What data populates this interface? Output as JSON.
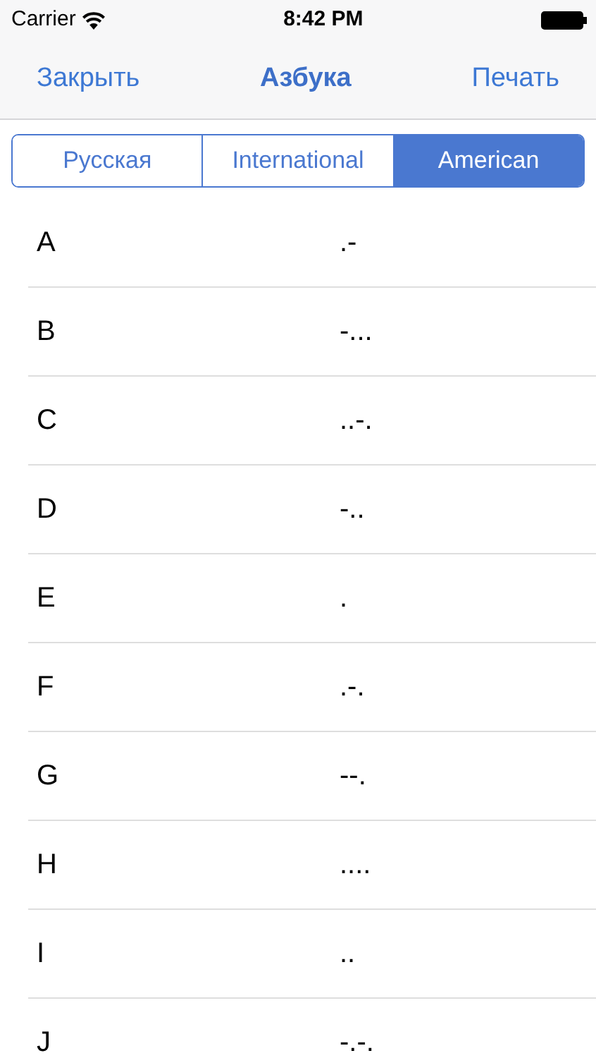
{
  "status_bar": {
    "carrier": "Carrier",
    "time": "8:42 PM"
  },
  "nav_bar": {
    "left_button": "Закрыть",
    "title": "Азбука",
    "right_button": "Печать"
  },
  "segments": [
    {
      "label": "Русская",
      "selected": false
    },
    {
      "label": "International",
      "selected": false
    },
    {
      "label": "American",
      "selected": true
    }
  ],
  "rows": [
    {
      "letter": "A",
      "code": ".-"
    },
    {
      "letter": "B",
      "code": "-..."
    },
    {
      "letter": "C",
      "code": "..-."
    },
    {
      "letter": "D",
      "code": "-.."
    },
    {
      "letter": "E",
      "code": "."
    },
    {
      "letter": "F",
      "code": ".-."
    },
    {
      "letter": "G",
      "code": "--."
    },
    {
      "letter": "H",
      "code": "...."
    },
    {
      "letter": "I",
      "code": ".."
    },
    {
      "letter": "J",
      "code": "-.-."
    }
  ]
}
